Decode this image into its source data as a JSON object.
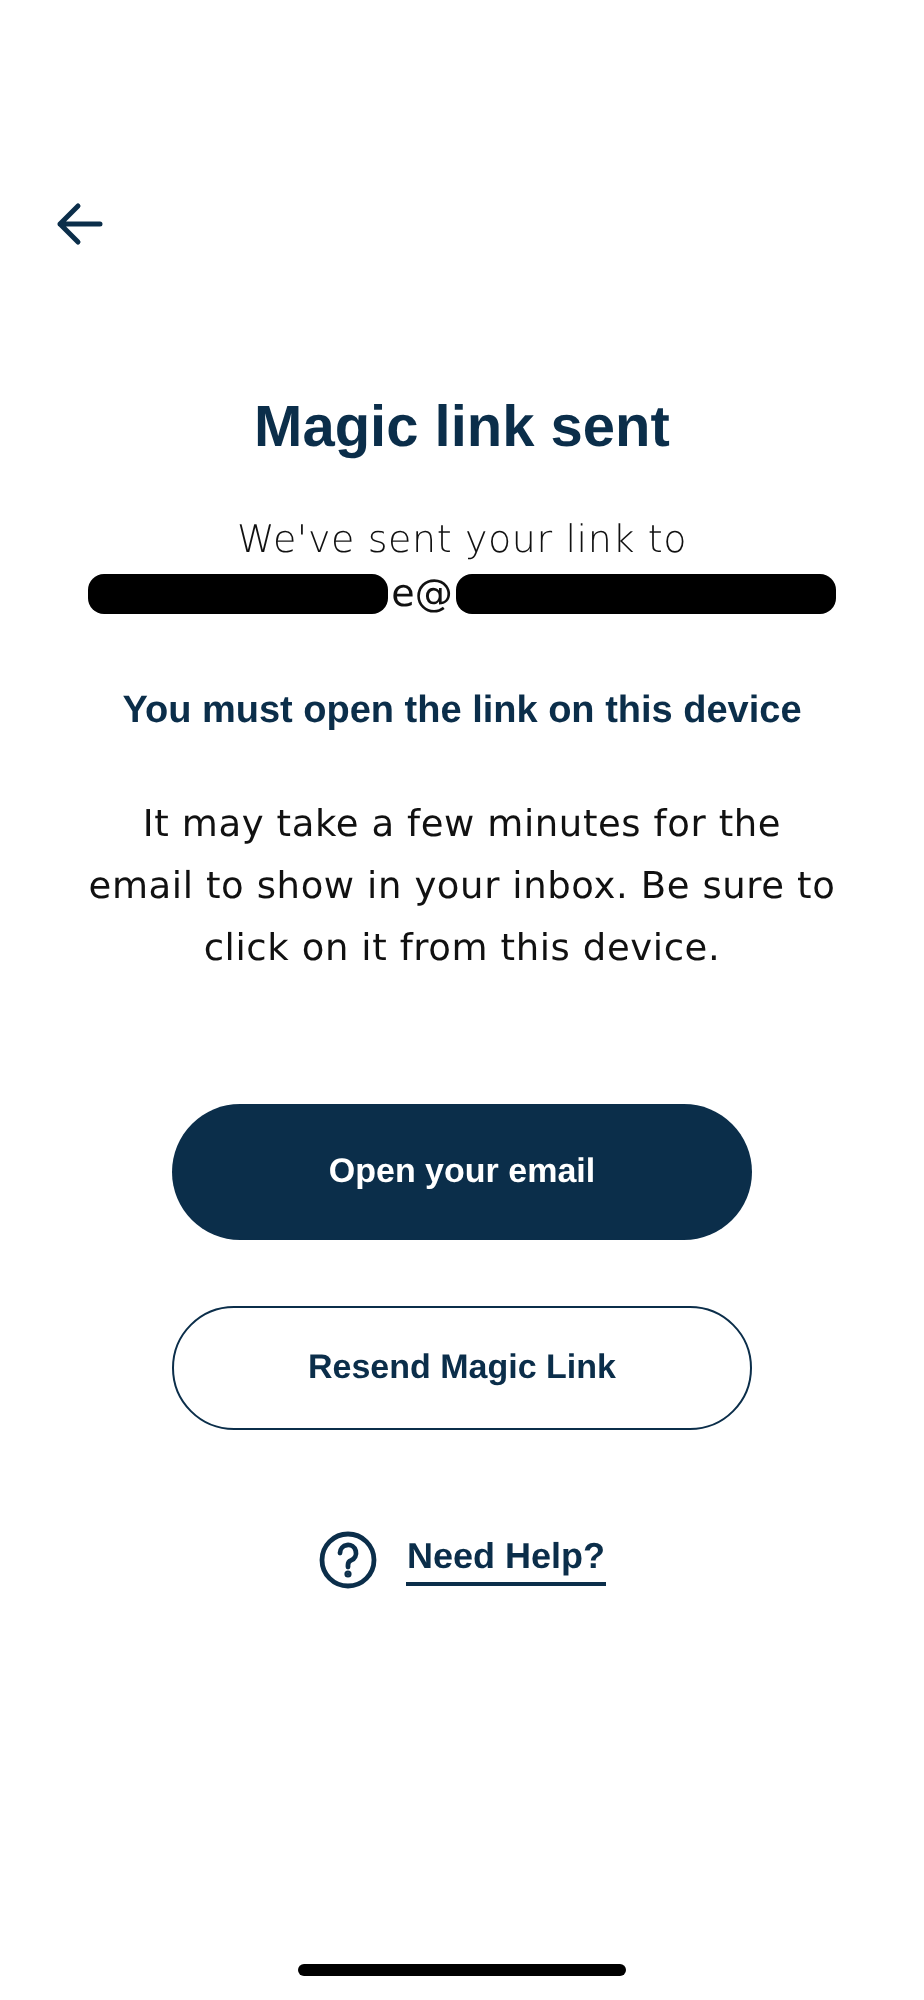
{
  "title": "Magic link sent",
  "sent_to": "We've sent your link to",
  "email_visible": "e@",
  "warning": "You must open the link on this device",
  "body": "It may take a few minutes for the email to show in your inbox. Be sure to click on it from this device.",
  "primary_button": "Open your email",
  "secondary_button": "Resend Magic Link",
  "help_link": "Need Help?"
}
